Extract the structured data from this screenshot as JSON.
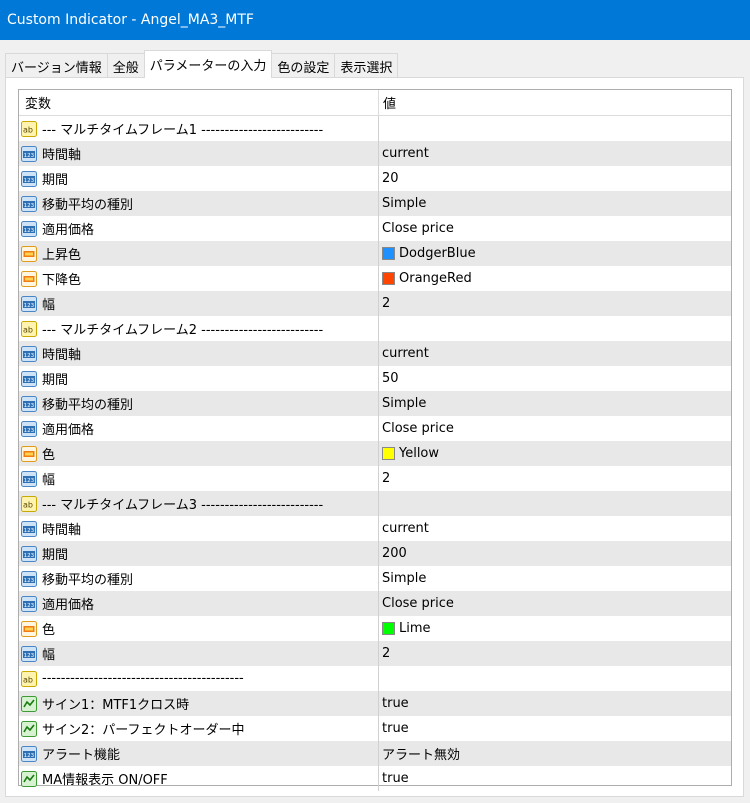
{
  "window": {
    "title": "Custom Indicator - Angel_MA3_MTF"
  },
  "tabs": [
    {
      "label": "バージョン情報"
    },
    {
      "label": "全般"
    },
    {
      "label": "パラメーターの入力"
    },
    {
      "label": "色の設定"
    },
    {
      "label": "表示選択"
    }
  ],
  "active_tab": "パラメーターの入力",
  "grid": {
    "columns": [
      "変数",
      "値"
    ],
    "rows": [
      {
        "icon": "string-icon",
        "variable": "--- マルチタイムフレーム1 --------------------------",
        "value": "",
        "color": ""
      },
      {
        "icon": "number-icon",
        "variable": "時間軸",
        "value": "current",
        "color": ""
      },
      {
        "icon": "number-icon",
        "variable": "期間",
        "value": "20",
        "color": ""
      },
      {
        "icon": "number-icon",
        "variable": "移動平均の種別",
        "value": "Simple",
        "color": ""
      },
      {
        "icon": "number-icon",
        "variable": "適用価格",
        "value": "Close price",
        "color": ""
      },
      {
        "icon": "color-icon",
        "variable": "上昇色",
        "value": "DodgerBlue",
        "color": "#1e90ff"
      },
      {
        "icon": "color-icon",
        "variable": "下降色",
        "value": "OrangeRed",
        "color": "#ff4500"
      },
      {
        "icon": "number-icon",
        "variable": "幅",
        "value": "2",
        "color": ""
      },
      {
        "icon": "string-icon",
        "variable": "--- マルチタイムフレーム2 --------------------------",
        "value": "",
        "color": ""
      },
      {
        "icon": "number-icon",
        "variable": "時間軸",
        "value": "current",
        "color": ""
      },
      {
        "icon": "number-icon",
        "variable": "期間",
        "value": "50",
        "color": ""
      },
      {
        "icon": "number-icon",
        "variable": "移動平均の種別",
        "value": "Simple",
        "color": ""
      },
      {
        "icon": "number-icon",
        "variable": "適用価格",
        "value": "Close price",
        "color": ""
      },
      {
        "icon": "color-icon",
        "variable": "色",
        "value": "Yellow",
        "color": "#ffff00"
      },
      {
        "icon": "number-icon",
        "variable": "幅",
        "value": "2",
        "color": ""
      },
      {
        "icon": "string-icon",
        "variable": "--- マルチタイムフレーム3 --------------------------",
        "value": "",
        "color": ""
      },
      {
        "icon": "number-icon",
        "variable": "時間軸",
        "value": "current",
        "color": ""
      },
      {
        "icon": "number-icon",
        "variable": "期間",
        "value": "200",
        "color": ""
      },
      {
        "icon": "number-icon",
        "variable": "移動平均の種別",
        "value": "Simple",
        "color": ""
      },
      {
        "icon": "number-icon",
        "variable": "適用価格",
        "value": "Close price",
        "color": ""
      },
      {
        "icon": "color-icon",
        "variable": "色",
        "value": "Lime",
        "color": "#00ff00"
      },
      {
        "icon": "number-icon",
        "variable": "幅",
        "value": "2",
        "color": ""
      },
      {
        "icon": "string-icon",
        "variable": "-------------------------------------------",
        "value": "",
        "color": ""
      },
      {
        "icon": "bool-icon",
        "variable": "サイン1：MTF1クロス時",
        "value": "true",
        "color": ""
      },
      {
        "icon": "bool-icon",
        "variable": "サイン2：パーフェクトオーダー中",
        "value": "true",
        "color": ""
      },
      {
        "icon": "number-icon",
        "variable": "アラート機能",
        "value": "アラート無効",
        "color": ""
      },
      {
        "icon": "bool-icon",
        "variable": "MA情報表示 ON/OFF",
        "value": "true",
        "color": ""
      }
    ]
  }
}
